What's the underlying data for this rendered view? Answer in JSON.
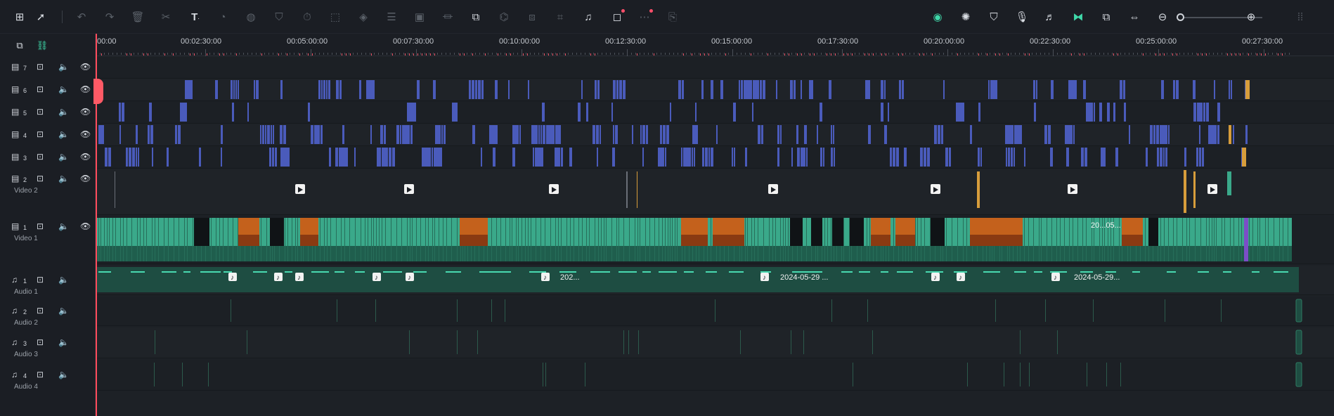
{
  "toolbar": {
    "left_icons": [
      "layout-icon",
      "select-arrow-icon",
      "undo-icon",
      "redo-icon",
      "delete-icon",
      "scissors-icon",
      "text-icon",
      "speed-icon",
      "color-icon",
      "keyframe-icon",
      "timer-icon",
      "crop-frame-icon",
      "mask-icon",
      "adjust-icon",
      "ai-icon",
      "audio-stretch-icon",
      "speech-to-text-icon",
      "voice-icon",
      "freeze-frame-icon",
      "crop-icon",
      "beat-sync-icon",
      "marker-frame-icon",
      "more-icon",
      "translate-icon"
    ],
    "right_icons": [
      "ai-copilot-icon",
      "render-icon",
      "marker-icon",
      "microphone-icon",
      "music-icon",
      "snap-icon",
      "preview-icon",
      "fit-icon",
      "zoom-out-icon",
      "zoom-in-icon",
      "grip-icon"
    ],
    "zoom_level": 0.02
  },
  "ruler": {
    "labels": [
      "00:00",
      "00:02:30:00",
      "00:05:00:00",
      "00:07:30:00",
      "00:10:00:00",
      "00:12:30:00",
      "00:15:00:00",
      "00:17:30:00",
      "00:20:00:00",
      "00:22:30:00",
      "00:25:00:00",
      "00:27:30:00"
    ]
  },
  "tracks": [
    {
      "kind": "video",
      "number": "7",
      "name": ""
    },
    {
      "kind": "video",
      "number": "6",
      "name": ""
    },
    {
      "kind": "video",
      "number": "5",
      "name": ""
    },
    {
      "kind": "video",
      "number": "4",
      "name": ""
    },
    {
      "kind": "video",
      "number": "3",
      "name": ""
    },
    {
      "kind": "video",
      "number": "2",
      "name": "Video 2"
    },
    {
      "kind": "video",
      "number": "1",
      "name": "Video 1"
    },
    {
      "kind": "audio",
      "number": "1",
      "name": "Audio 1"
    },
    {
      "kind": "audio",
      "number": "2",
      "name": "Audio 2"
    },
    {
      "kind": "audio",
      "number": "3",
      "name": "Audio 3"
    },
    {
      "kind": "audio",
      "number": "4",
      "name": "Audio 4"
    }
  ],
  "clip_labels": [
    "2024-05-29 ...",
    "2024-05-29...",
    "202...",
    "20...05..."
  ],
  "colors": {
    "accent": "#3fd8a9",
    "playhead": "#ff4b5c",
    "title_clip": "#4a5bbb",
    "video_clip": "#3aa98a",
    "orange_clip": "#d79d3b"
  }
}
